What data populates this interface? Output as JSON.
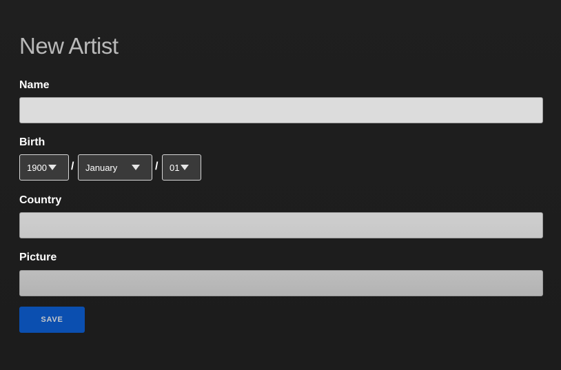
{
  "form": {
    "title": "New Artist",
    "name": {
      "label": "Name",
      "value": "",
      "placeholder": ""
    },
    "birth": {
      "label": "Birth",
      "year": "1900",
      "month": "January",
      "day": "01",
      "separator": "/"
    },
    "country": {
      "label": "Country",
      "value": "",
      "placeholder": ""
    },
    "picture": {
      "label": "Picture",
      "value": "",
      "placeholder": ""
    },
    "save_label": "SAVE"
  },
  "colors": {
    "background": "#1d1d1d",
    "title": "#b9b9b9",
    "select_bg": "#3a3a3a",
    "save_button": "#0b4fb0"
  }
}
